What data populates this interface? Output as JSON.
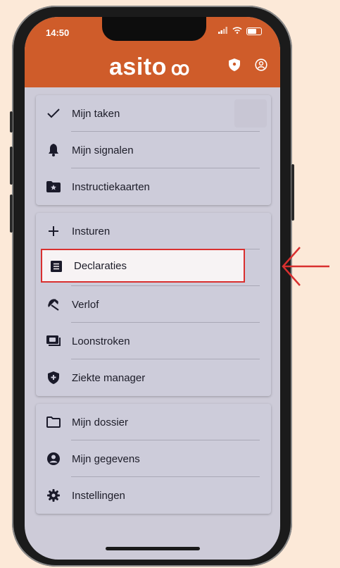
{
  "status_bar": {
    "time": "14:50"
  },
  "header": {
    "logo_text": "asito",
    "logo_mark": "ꝏ",
    "color": "#cf5c2a",
    "icons": [
      "shield-icon",
      "account-circle-icon"
    ]
  },
  "menu": {
    "group1": [
      {
        "label": "Mijn taken",
        "icon": "check-icon"
      },
      {
        "label": "Mijn signalen",
        "icon": "bell-icon"
      },
      {
        "label": "Instructiekaarten",
        "icon": "folder-star-icon"
      }
    ],
    "group2": [
      {
        "label": "Insturen",
        "icon": "plus-icon"
      },
      {
        "label": "Declaraties",
        "icon": "receipt-icon",
        "highlighted": true
      },
      {
        "label": "Verlof",
        "icon": "beach-umbrella-icon"
      },
      {
        "label": "Loonstroken",
        "icon": "payslip-icon"
      },
      {
        "label": "Ziekte manager",
        "icon": "shield-plus-icon"
      }
    ],
    "group3": [
      {
        "label": "Mijn dossier",
        "icon": "folder-icon"
      },
      {
        "label": "Mijn gegevens",
        "icon": "account-icon"
      },
      {
        "label": "Instellingen",
        "icon": "gear-icon"
      }
    ]
  },
  "annotation": {
    "highlight_color": "#d9302f",
    "arrow": "left-arrow"
  }
}
